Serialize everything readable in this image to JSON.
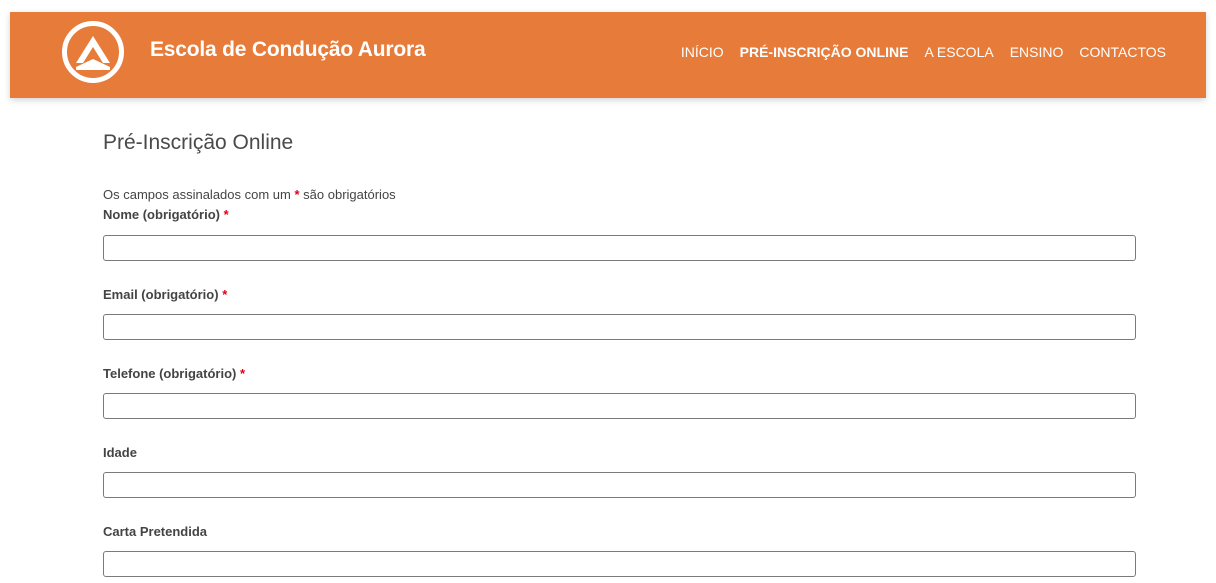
{
  "colors": {
    "header_bg": "#e77b39",
    "required_marker": "#e0001b",
    "text": "#444444"
  },
  "header": {
    "logo_icon": "aurora-triangle-logo-icon",
    "brand": "Escola de Condução Aurora"
  },
  "nav": {
    "items": [
      {
        "label": "INÍCIO",
        "active": false
      },
      {
        "label": "PRÉ-INSCRIÇÃO ONLINE",
        "active": true
      },
      {
        "label": "A ESCOLA",
        "active": false
      },
      {
        "label": "ENSINO",
        "active": false
      },
      {
        "label": "CONTACTOS",
        "active": false
      }
    ]
  },
  "page": {
    "title": "Pré-Inscrição Online"
  },
  "form": {
    "note_prefix": "Os campos assinalados com um",
    "required_marker": "*",
    "note_suffix": "são obrigatórios",
    "fields": [
      {
        "label": "Nome (obrigatório)",
        "required": true,
        "value": "",
        "placeholder": ""
      },
      {
        "label": "Email (obrigatório)",
        "required": true,
        "value": "",
        "placeholder": ""
      },
      {
        "label": "Telefone (obrigatório)",
        "required": true,
        "value": "",
        "placeholder": ""
      },
      {
        "label": "Idade",
        "required": false,
        "value": "",
        "placeholder": ""
      },
      {
        "label": "Carta Pretendida",
        "required": false,
        "value": "",
        "placeholder": ""
      }
    ]
  }
}
